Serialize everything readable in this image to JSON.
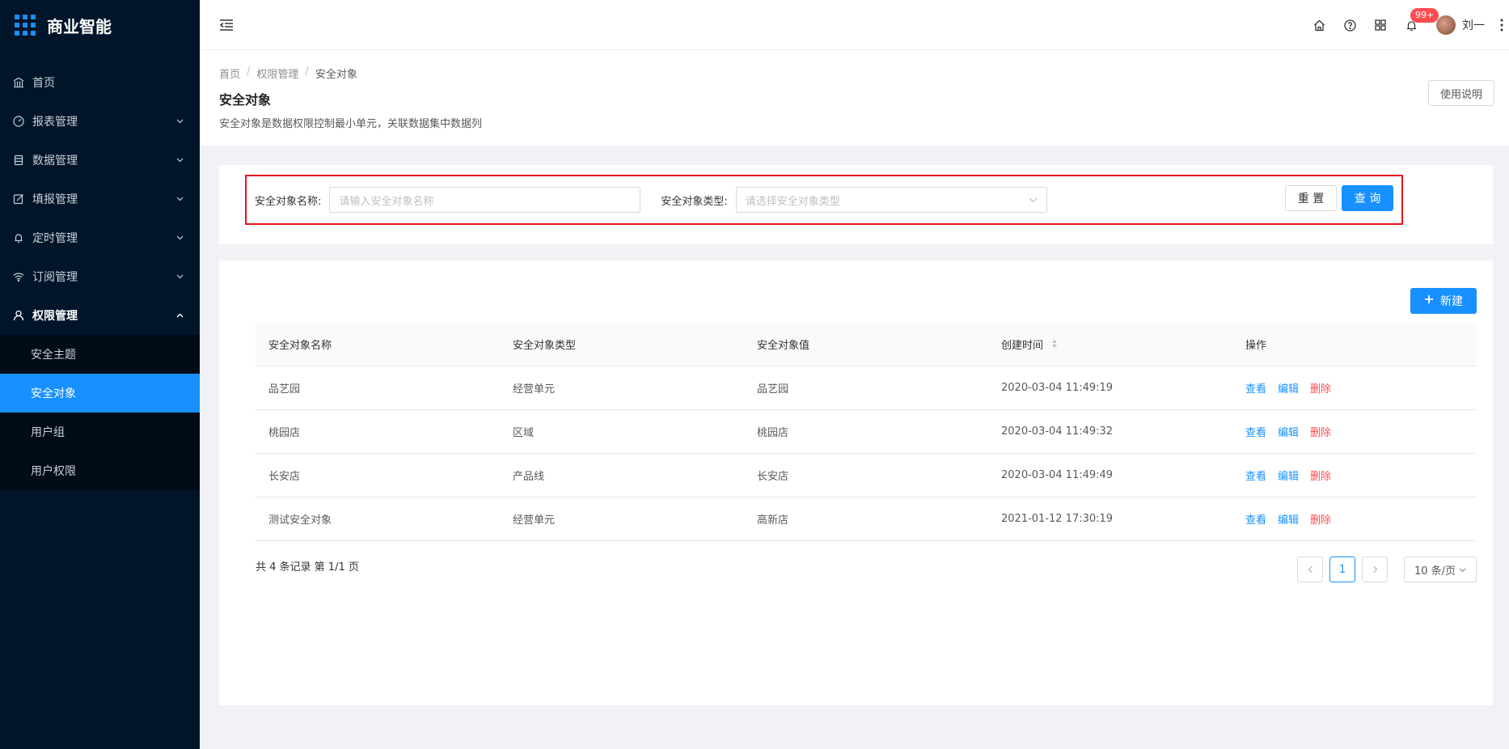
{
  "app": {
    "title": "商业智能"
  },
  "sidebar": {
    "items": [
      {
        "label": "首页",
        "icon": "bank-icon",
        "expandable": false
      },
      {
        "label": "报表管理",
        "icon": "dashboard-icon",
        "expandable": true
      },
      {
        "label": "数据管理",
        "icon": "database-icon",
        "expandable": true
      },
      {
        "label": "填报管理",
        "icon": "form-icon",
        "expandable": true
      },
      {
        "label": "定时管理",
        "icon": "bell-icon",
        "expandable": true
      },
      {
        "label": "订阅管理",
        "icon": "wifi-icon",
        "expandable": true
      },
      {
        "label": "权限管理",
        "icon": "user-icon",
        "expandable": true,
        "expanded": true
      }
    ],
    "sub_items": [
      "安全主题",
      "安全对象",
      "用户组",
      "用户权限"
    ],
    "selected_sub": "安全对象"
  },
  "header": {
    "notifications_badge": "99+",
    "username": "刘一"
  },
  "page": {
    "breadcrumb": [
      "首页",
      "权限管理",
      "安全对象"
    ],
    "title": "安全对象",
    "description": "安全对象是数据权限控制最小单元，关联数据集中数据列",
    "help_button": "使用说明"
  },
  "search": {
    "name_label": "安全对象名称:",
    "name_placeholder": "请输入安全对象名称",
    "type_label": "安全对象类型:",
    "type_placeholder": "请选择安全对象类型",
    "reset_label": "重 置",
    "query_label": "查 询"
  },
  "table": {
    "new_button": "新建",
    "columns": [
      "安全对象名称",
      "安全对象类型",
      "安全对象值",
      "创建时间",
      "操作"
    ],
    "rows": [
      {
        "name": "品艺园",
        "type": "经营单元",
        "value": "品艺园",
        "created": "2020-03-04 11:49:19"
      },
      {
        "name": "桃园店",
        "type": "区域",
        "value": "桃园店",
        "created": "2020-03-04 11:49:32"
      },
      {
        "name": "长安店",
        "type": "产品线",
        "value": "长安店",
        "created": "2020-03-04 11:49:49"
      },
      {
        "name": "测试安全对象",
        "type": "经营单元",
        "value": "高新店",
        "created": "2021-01-12 17:30:19"
      }
    ],
    "actions": {
      "view": "查看",
      "edit": "编辑",
      "delete": "删除"
    }
  },
  "pagination": {
    "total_text": "共 4 条记录 第 1/1 页",
    "current_page": "1",
    "page_size": "10 条/页"
  },
  "colors": {
    "primary": "#1890ff",
    "danger": "#ff4d4f",
    "sidebar_bg": "#001529",
    "highlight_border": "#e8141b"
  }
}
